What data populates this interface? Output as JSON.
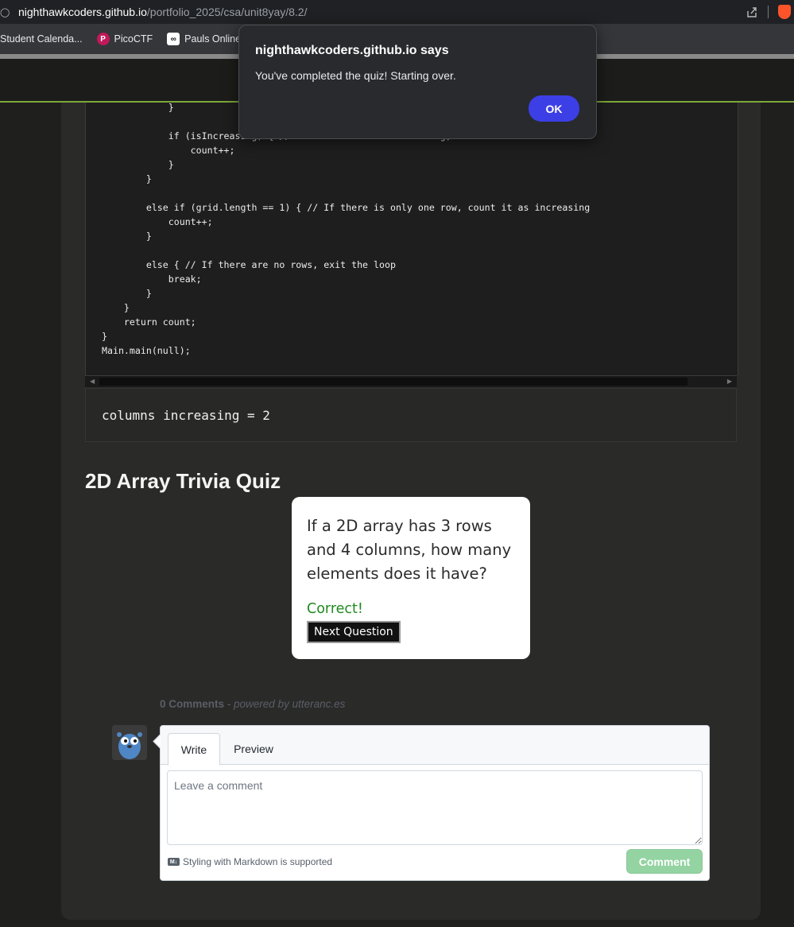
{
  "browser": {
    "url_host": "nighthawkcoders.github.io",
    "url_path": "/portfolio_2025/csa/unit8yay/8.2/",
    "bookmarks": [
      {
        "label": "Student Calenda...",
        "icon": "calendar-icon"
      },
      {
        "label": "PicoCTF",
        "icon": "picoctf-icon"
      },
      {
        "label": "Pauls Online Ma",
        "icon": "infinity-icon"
      }
    ]
  },
  "code": {
    "lines": [
      "            }",
      "",
      "            if (isIncreasing) { // If the column is increasing, increase the count",
      "                count++;",
      "            }",
      "        }",
      "",
      "        else if (grid.length == 1) { // If there is only one row, count it as increasing",
      "            count++;",
      "        }",
      "",
      "        else { // If there are no rows, exit the loop",
      "            break;",
      "        }",
      "    }",
      "    return count;",
      "}",
      "Main.main(null);"
    ]
  },
  "output": {
    "text": "columns increasing = 2"
  },
  "quiz": {
    "heading": "2D Array Trivia Quiz",
    "question": "If a 2D array has 3 rows and 4 columns, how many elements does it have?",
    "feedback": "Correct!",
    "next_button_label": "Next Question",
    "feedback_color": "#1e8a1e"
  },
  "comments": {
    "count_label": "0 Comments",
    "powered_by": " - powered by utteranc.es",
    "tab_write": "Write",
    "tab_preview": "Preview",
    "textarea_placeholder": "Leave a comment",
    "markdown_note": "Styling with Markdown is supported",
    "comment_button": "Comment"
  },
  "alert": {
    "title": "nighthawkcoders.github.io says",
    "message": "You've completed the quiz! Starting over.",
    "ok_label": "OK",
    "accent_color": "#3c3fe6"
  }
}
